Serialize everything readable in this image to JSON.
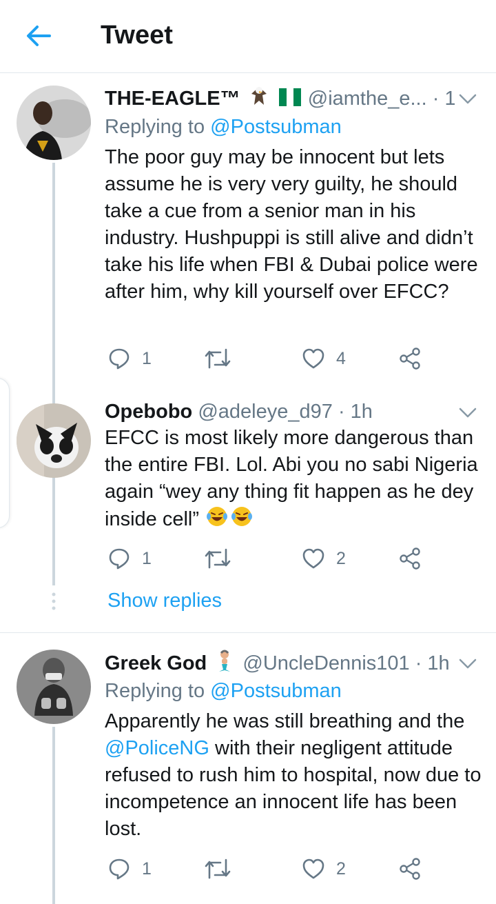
{
  "header": {
    "title": "Tweet"
  },
  "tweets": [
    {
      "name": "THE-EAGLE™",
      "handle": "@iamthe_e...",
      "time": "· 1h",
      "replying_prefix": "Replying to",
      "replying_to": "@Postsubman",
      "text": "The poor guy may be innocent but lets assume he is very very guilty, he should take a cue from a senior man in his industry. Hushpuppi is still alive and didn’t take his life when FBI & Dubai police were after him, why kill yourself over EFCC?",
      "replies": "1",
      "retweets": "",
      "likes": "4"
    },
    {
      "name": "Opebobo",
      "handle": "@adeleye_d97",
      "time": "· 1h",
      "text": "EFCC is most likely more dangerous than the entire FBI. Lol. Abi you no sabi Nigeria again “wey any thing fit happen as he dey inside cell”",
      "replies": "1",
      "retweets": "",
      "likes": "2",
      "show_replies": "Show replies"
    },
    {
      "name": "Greek God",
      "handle": "@UncleDennis101",
      "time": "· 1h",
      "replying_prefix": "Replying to",
      "replying_to": "@Postsubman",
      "text_before": "Apparently he was still breathing and the ",
      "mention": "@PoliceNG",
      "text_after": " with their negligent attitude refused to rush him to hospital, now due to incompetence an innocent life has been lost.",
      "replies": "1",
      "retweets": "",
      "likes": "2"
    }
  ],
  "colors": {
    "accent": "#1da1f2",
    "secondary_text": "#657786",
    "primary_text": "#14171a",
    "divider": "#e1e8ed",
    "thread_line": "#ccd6dd"
  },
  "icons": [
    "back-arrow-icon",
    "chevron-down-icon",
    "reply-icon",
    "retweet-icon",
    "like-icon",
    "share-icon",
    "eagle-emoji",
    "nigeria-flag-emoji",
    "laughing-emoji",
    "merman-emoji"
  ]
}
